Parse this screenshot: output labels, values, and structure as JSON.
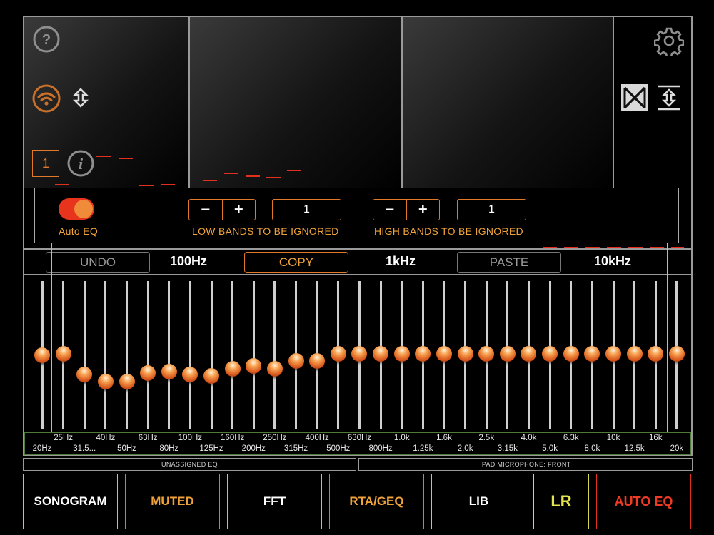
{
  "channel": "1",
  "auto_eq": {
    "toggle_label": "Auto EQ",
    "low_bands_label": "LOW BANDS TO BE IGNORED",
    "high_bands_label": "HIGH BANDS TO BE IGNORED",
    "low_bands_value": "1",
    "high_bands_value": "1",
    "minus": "−",
    "plus": "+"
  },
  "toolbar": {
    "undo": "UNDO",
    "copy": "COPY",
    "paste": "PASTE",
    "freq_100": "100Hz",
    "freq_1k": "1kHz",
    "freq_10k": "10kHz"
  },
  "bands_top": [
    "25Hz",
    "40Hz",
    "63Hz",
    "100Hz",
    "160Hz",
    "250Hz",
    "400Hz",
    "630Hz",
    "1.0k",
    "1.6k",
    "2.5k",
    "4.0k",
    "6.3k",
    "10k",
    "16k"
  ],
  "bands_bottom": [
    "20Hz",
    "31.5...",
    "50Hz",
    "80Hz",
    "125Hz",
    "200Hz",
    "315Hz",
    "500Hz",
    "800Hz",
    "1.25k",
    "2.0k",
    "3.15k",
    "5.0k",
    "8.0k",
    "12.5k",
    "20k"
  ],
  "fader_levels": [
    0.5,
    0.51,
    0.37,
    0.32,
    0.32,
    0.38,
    0.39,
    0.37,
    0.36,
    0.41,
    0.43,
    0.41,
    0.46,
    0.46,
    0.51,
    0.51,
    0.51,
    0.51,
    0.51,
    0.51,
    0.51,
    0.51,
    0.51,
    0.51,
    0.51,
    0.51,
    0.51,
    0.51,
    0.51,
    0.51,
    0.51
  ],
  "status": {
    "left": "UNASSIGNED EQ",
    "right": "iPAD MICROPHONE: FRONT"
  },
  "bottom": {
    "sonogram": "SONOGRAM",
    "muted": "MUTED",
    "fft": "FFT",
    "rta_geq": "RTA/GEQ",
    "lib": "LIB",
    "lr": "LR",
    "auto_eq": "AUTO EQ"
  },
  "colors": {
    "accent_orange": "#e07a2a",
    "red": "#e2301f",
    "yellow": "#d8d84a",
    "frame_gray": "#9a9a9a"
  },
  "icons": [
    "help-icon",
    "settings-gear-icon",
    "wifi-icon",
    "vertical-arrows-icon",
    "info-icon",
    "bowtie-icon",
    "expand-vertical-icon"
  ]
}
